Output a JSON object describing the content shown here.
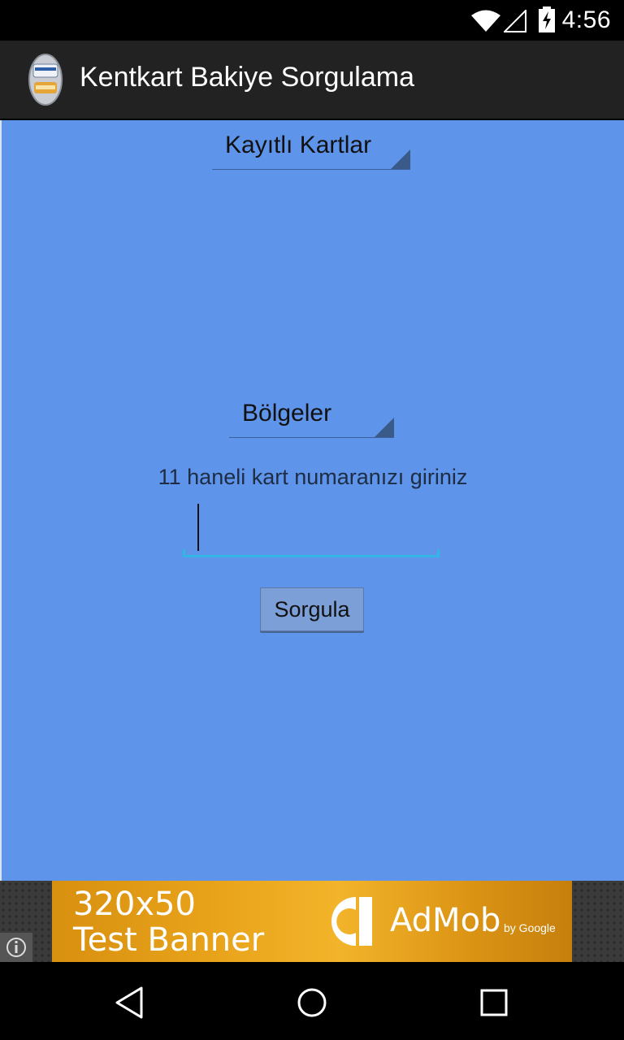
{
  "status_bar": {
    "time": "4:56",
    "icons": [
      "wifi-icon",
      "signal-icon",
      "battery-charging-icon"
    ]
  },
  "action_bar": {
    "app_icon": "kentkart-card-icon",
    "title": "Kentkart Bakiye Sorgulama"
  },
  "main": {
    "saved_cards_spinner": {
      "selected": "Kayıtlı Kartlar"
    },
    "regions_spinner": {
      "selected": "Bölgeler"
    },
    "card_prompt": "11 haneli kart numaranızı giriniz",
    "card_number_input": {
      "value": "",
      "placeholder": ""
    },
    "query_button": "Sorgula",
    "background_color": "#5e94e9"
  },
  "ad_banner": {
    "size_text": "320x50",
    "sub_text": "Test Banner",
    "brand": "AdMob",
    "by": "by Google",
    "info_icon": "info-icon"
  },
  "nav_bar": {
    "icons": [
      "back-icon",
      "home-icon",
      "recents-icon"
    ]
  }
}
